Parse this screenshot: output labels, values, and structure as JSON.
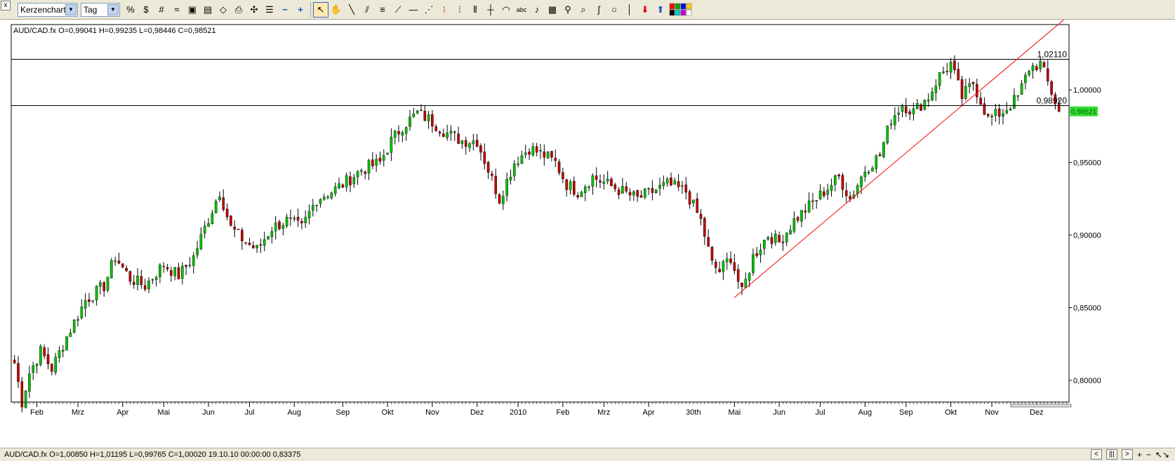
{
  "toolbar": {
    "close_glyph": "x",
    "chart_type": "Kerzenchart",
    "timeframe": "Tag",
    "tool_label_text": "abc",
    "palette": [
      "#ff0000",
      "#00aa00",
      "#0000ff",
      "#ffcc00",
      "#000000",
      "#00cccc",
      "#cc00cc",
      "#ffffff"
    ]
  },
  "chart": {
    "header_text": "AUD/CAD.fx O=0,99041 H=0,99235 L=0,98446 C=0,98521",
    "accent_up": "#00c000",
    "accent_down": "#c00000",
    "trendline_color": "#ff0000",
    "current_price_label": "0,98521",
    "current_price_bg": "#33dd33",
    "hlines": [
      {
        "label": "1,02110",
        "value": 1.0211
      },
      {
        "label": "0,98920",
        "value": 0.9892
      }
    ],
    "annotation": "30th"
  },
  "chart_data": {
    "type": "candlestick",
    "title": "AUD/CAD.fx",
    "ylim": [
      0.785,
      1.045
    ],
    "y_ticks": [
      {
        "label": "0,80000",
        "value": 0.8
      },
      {
        "label": "0,85000",
        "value": 0.85
      },
      {
        "label": "0,90000",
        "value": 0.9
      },
      {
        "label": "0,95000",
        "value": 0.95
      },
      {
        "label": "1,00000",
        "value": 1.0
      }
    ],
    "x_count": 243,
    "x_ticks": [
      {
        "label": "Feb",
        "index": 6
      },
      {
        "label": "Mrz",
        "index": 17
      },
      {
        "label": "Apr",
        "index": 29
      },
      {
        "label": "Mai",
        "index": 40
      },
      {
        "label": "Jun",
        "index": 52
      },
      {
        "label": "Jul",
        "index": 63
      },
      {
        "label": "Aug",
        "index": 75
      },
      {
        "label": "Sep",
        "index": 88
      },
      {
        "label": "Okt",
        "index": 100
      },
      {
        "label": "Nov",
        "index": 112
      },
      {
        "label": "Dez",
        "index": 124
      },
      {
        "label": "2010",
        "index": 135
      },
      {
        "label": "Feb",
        "index": 147
      },
      {
        "label": "Mrz",
        "index": 158
      },
      {
        "label": "Apr",
        "index": 170
      },
      {
        "label": "Mai",
        "index": 193
      },
      {
        "label": "Jun",
        "index": 205
      },
      {
        "label": "Jul",
        "index": 216
      },
      {
        "label": "Aug",
        "index": 228
      },
      {
        "label": "Sep",
        "index": 239
      },
      {
        "label": "Okt",
        "index": 251
      },
      {
        "label": "Nov",
        "index": 262
      },
      {
        "label": "Dez",
        "index": 274
      }
    ],
    "annotation_index": 182,
    "close_anchors": [
      [
        0,
        0.812
      ],
      [
        2,
        0.785
      ],
      [
        4,
        0.805
      ],
      [
        7,
        0.82
      ],
      [
        10,
        0.808
      ],
      [
        14,
        0.83
      ],
      [
        19,
        0.855
      ],
      [
        24,
        0.865
      ],
      [
        27,
        0.885
      ],
      [
        31,
        0.87
      ],
      [
        35,
        0.865
      ],
      [
        40,
        0.88
      ],
      [
        44,
        0.872
      ],
      [
        48,
        0.885
      ],
      [
        51,
        0.905
      ],
      [
        55,
        0.93
      ],
      [
        58,
        0.905
      ],
      [
        62,
        0.895
      ],
      [
        65,
        0.89
      ],
      [
        69,
        0.905
      ],
      [
        73,
        0.91
      ],
      [
        77,
        0.905
      ],
      [
        81,
        0.925
      ],
      [
        85,
        0.93
      ],
      [
        88,
        0.935
      ],
      [
        93,
        0.945
      ],
      [
        98,
        0.95
      ],
      [
        101,
        0.965
      ],
      [
        104,
        0.975
      ],
      [
        108,
        0.984
      ],
      [
        111,
        0.98
      ],
      [
        116,
        0.97
      ],
      [
        120,
        0.965
      ],
      [
        124,
        0.965
      ],
      [
        127,
        0.945
      ],
      [
        130,
        0.925
      ],
      [
        134,
        0.95
      ],
      [
        138,
        0.96
      ],
      [
        142,
        0.955
      ],
      [
        145,
        0.95
      ],
      [
        148,
        0.935
      ],
      [
        151,
        0.93
      ],
      [
        155,
        0.94
      ],
      [
        159,
        0.935
      ],
      [
        163,
        0.93
      ],
      [
        167,
        0.925
      ],
      [
        171,
        0.93
      ],
      [
        175,
        0.935
      ],
      [
        180,
        0.93
      ],
      [
        184,
        0.91
      ],
      [
        187,
        0.88
      ],
      [
        189,
        0.875
      ],
      [
        192,
        0.885
      ],
      [
        195,
        0.86
      ],
      [
        198,
        0.885
      ],
      [
        202,
        0.9
      ],
      [
        205,
        0.895
      ],
      [
        209,
        0.91
      ],
      [
        213,
        0.92
      ],
      [
        217,
        0.93
      ],
      [
        221,
        0.94
      ],
      [
        224,
        0.925
      ],
      [
        228,
        0.945
      ],
      [
        232,
        0.955
      ],
      [
        235,
        0.98
      ],
      [
        238,
        0.99
      ],
      [
        241,
        0.985
      ],
      [
        245,
        0.995
      ],
      [
        248,
        1.01
      ],
      [
        251,
        1.018
      ],
      [
        254,
        0.995
      ],
      [
        257,
        1.005
      ],
      [
        261,
        0.98
      ],
      [
        265,
        0.985
      ],
      [
        269,
        0.995
      ],
      [
        272,
        1.015
      ],
      [
        275,
        1.018
      ],
      [
        277,
        1.005
      ],
      [
        280,
        0.9852
      ]
    ],
    "trendline": [
      [
        193,
        0.857
      ],
      [
        283,
        1.052
      ]
    ]
  },
  "status": {
    "info": "AUD/CAD.fx O=1,00850 H=1,01195 L=0,99765 C=1,00020   19.10.10 00:00:00 0,83375",
    "btn_left": "<",
    "btn_bars": "|||",
    "btn_right": ">",
    "btn_plus": "+",
    "btn_minus": "−",
    "btn_fit": "↖↘"
  }
}
